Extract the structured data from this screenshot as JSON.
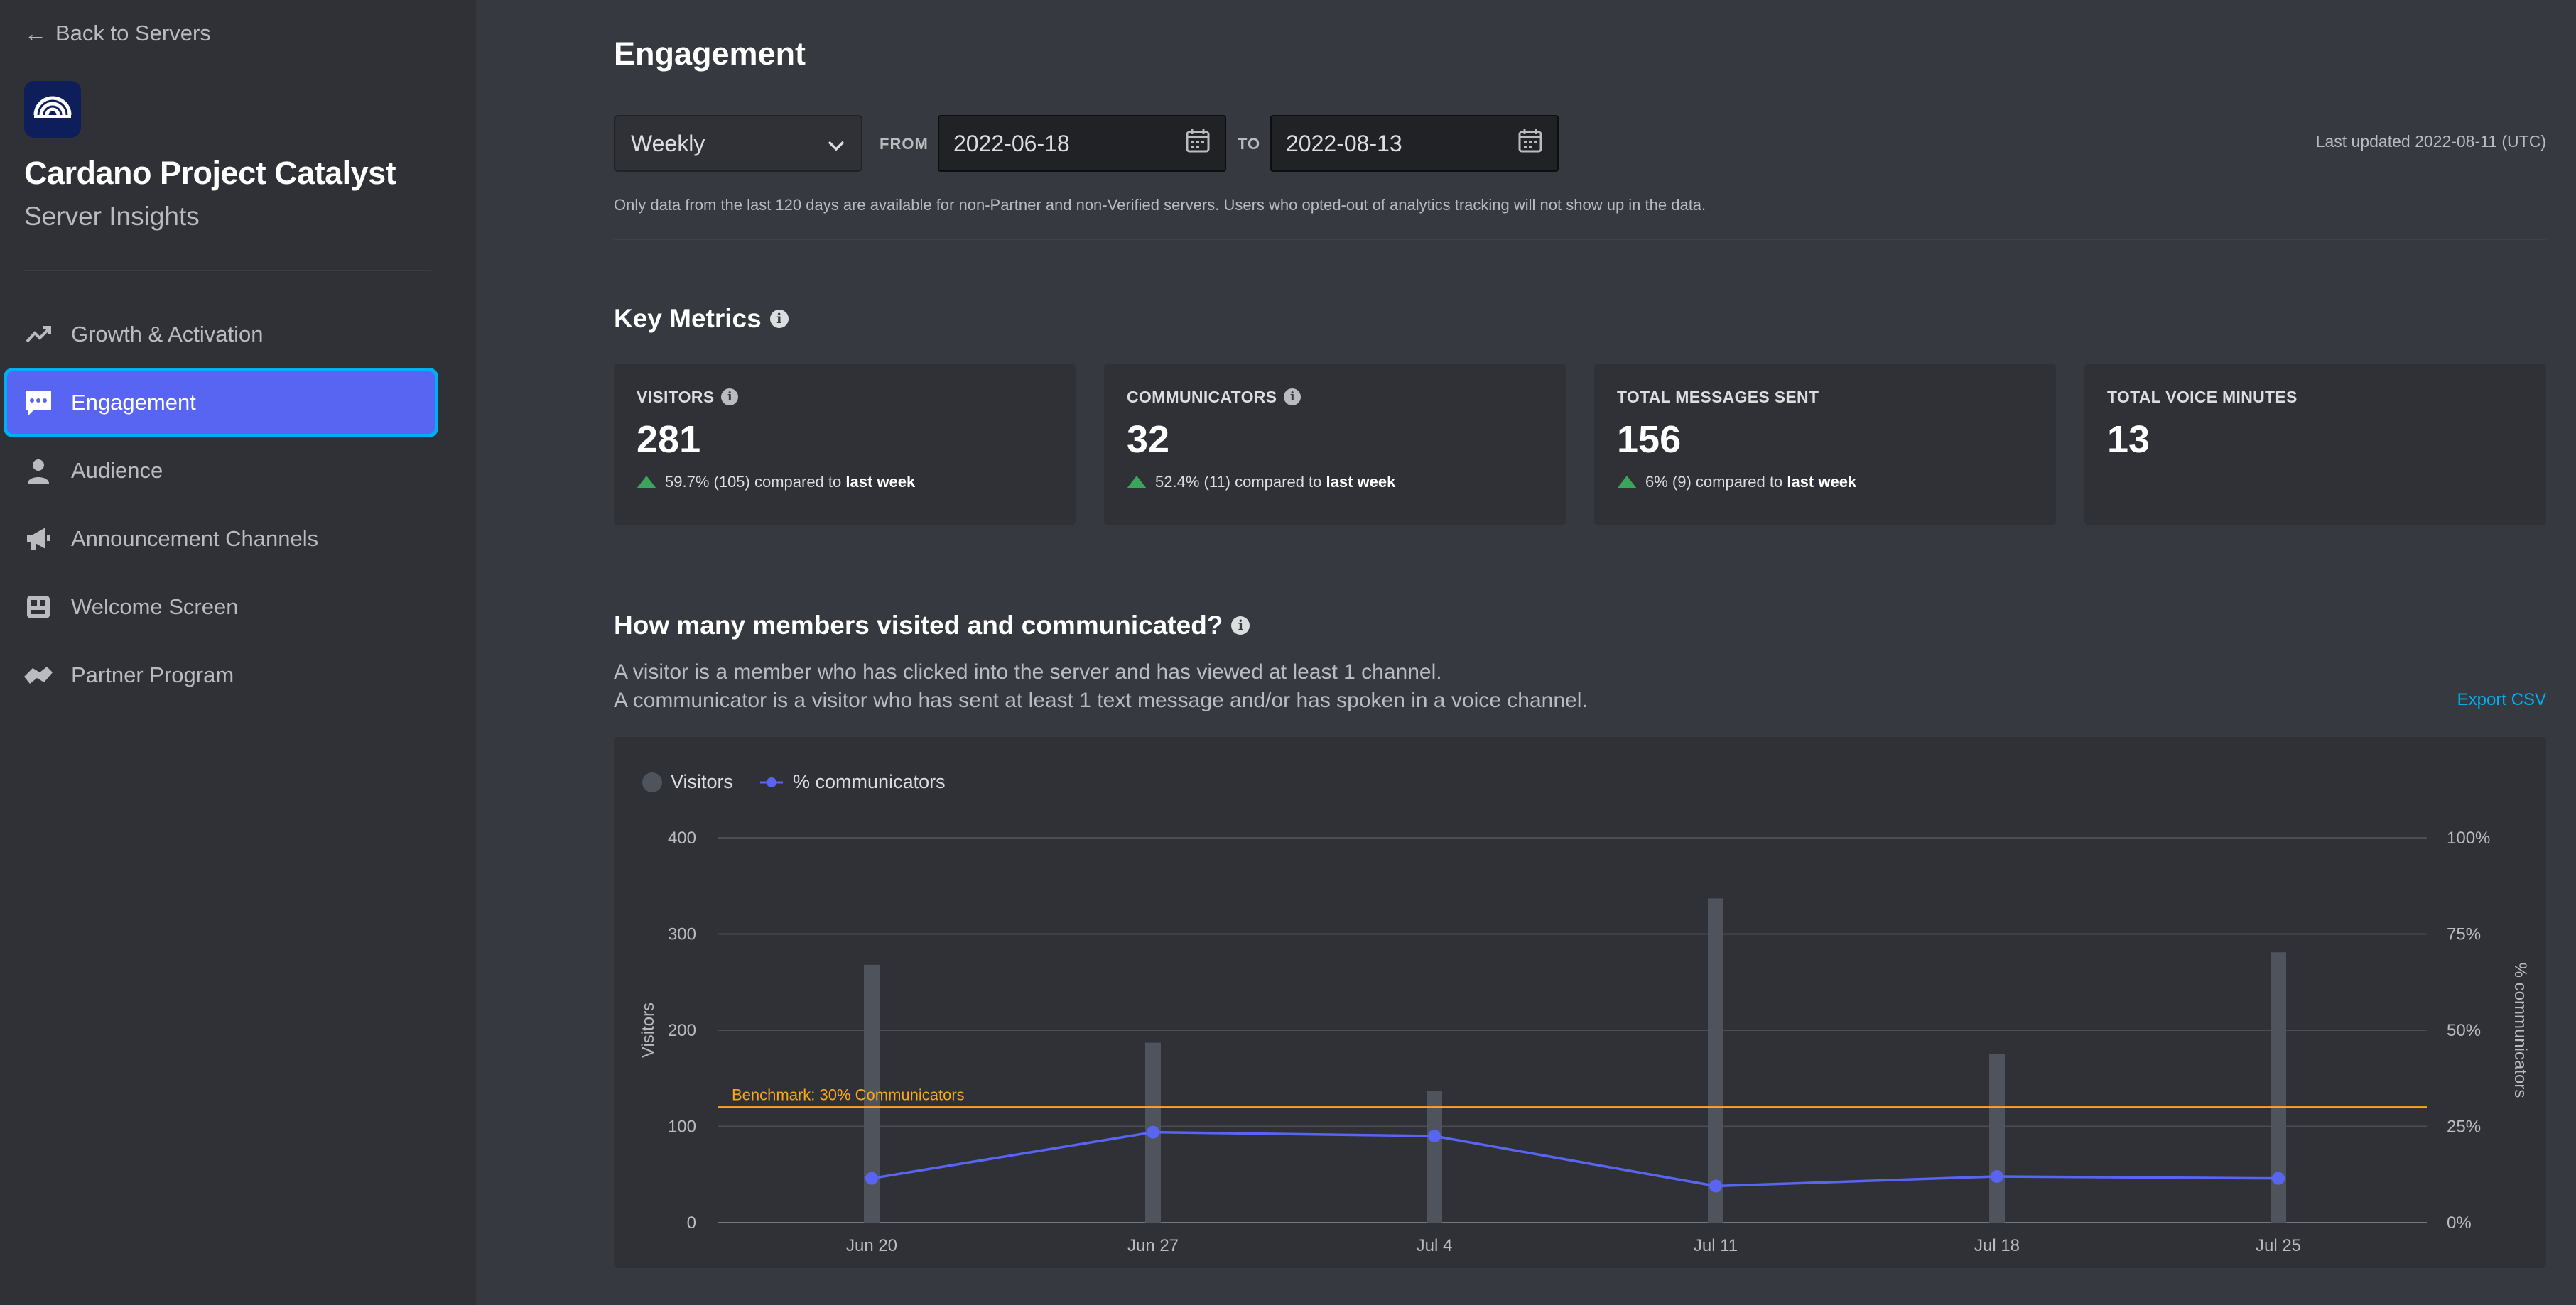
{
  "sidebar": {
    "back_label": "Back to Servers",
    "server_name": "Cardano Project Catalyst",
    "server_subtitle": "Server Insights",
    "items": [
      {
        "label": "Growth & Activation",
        "icon": "trending-up-icon"
      },
      {
        "label": "Engagement",
        "icon": "chat-bubble-icon",
        "active": true
      },
      {
        "label": "Audience",
        "icon": "person-icon"
      },
      {
        "label": "Announcement Channels",
        "icon": "megaphone-icon"
      },
      {
        "label": "Welcome Screen",
        "icon": "welcome-screen-icon"
      },
      {
        "label": "Partner Program",
        "icon": "partner-icon"
      }
    ]
  },
  "header": {
    "title": "Engagement",
    "interval": "Weekly",
    "from_label": "FROM",
    "from_date": "2022-06-18",
    "to_label": "TO",
    "to_date": "2022-08-13",
    "last_updated": "Last updated 2022-08-11 (UTC)",
    "note": "Only data from the last 120 days are available for non-Partner and non-Verified servers. Users who opted-out of analytics tracking will not show up in the data."
  },
  "key_metrics": {
    "title": "Key Metrics",
    "cards": [
      {
        "label": "VISITORS",
        "value": "281",
        "delta": "59.7% (105) compared to",
        "delta_bold": "last week",
        "has_info": true
      },
      {
        "label": "COMMUNICATORS",
        "value": "32",
        "delta": "52.4% (11) compared to",
        "delta_bold": "last week",
        "has_info": true
      },
      {
        "label": "TOTAL MESSAGES SENT",
        "value": "156",
        "delta": "6% (9) compared to",
        "delta_bold": "last week",
        "has_info": false
      },
      {
        "label": "TOTAL VOICE MINUTES",
        "value": "13",
        "delta": "",
        "delta_bold": "",
        "has_info": false
      }
    ]
  },
  "visits_section": {
    "title": "How many members visited and communicated?",
    "desc1": "A visitor is a member who has clicked into the server and has viewed at least 1 channel.",
    "desc2": "A communicator is a visitor who has sent at least 1 text message and/or has spoken in a voice channel.",
    "export_label": "Export CSV"
  },
  "colors": {
    "accent": "#5865f2",
    "bars": "#4f545c",
    "benchmark": "#faa81a",
    "positive": "#3ba55c",
    "link": "#00aff4"
  },
  "chart_data": {
    "type": "bar",
    "categories": [
      "Jun 20",
      "Jun 27",
      "Jul 4",
      "Jul 11",
      "Jul 18",
      "Jul 25"
    ],
    "series": [
      {
        "name": "Visitors",
        "type": "bar",
        "axis": "left",
        "values": [
          268,
          187,
          137,
          337,
          175,
          281
        ]
      },
      {
        "name": "% communicators",
        "type": "line",
        "axis": "right",
        "values": [
          11.5,
          23.5,
          22.5,
          9.5,
          12,
          11.5
        ]
      }
    ],
    "ylabel": "Visitors",
    "ylabel_right": "% communicators",
    "ylim": [
      0,
      400
    ],
    "yticks": [
      "0",
      "100",
      "200",
      "300",
      "400"
    ],
    "ylim_right": [
      0,
      100
    ],
    "yticks_right": [
      "0%",
      "25%",
      "50%",
      "75%",
      "100%"
    ],
    "benchmark": {
      "label": "Benchmark: 30% Communicators",
      "value": 30
    },
    "legend_position": "top-left",
    "grid": true
  }
}
